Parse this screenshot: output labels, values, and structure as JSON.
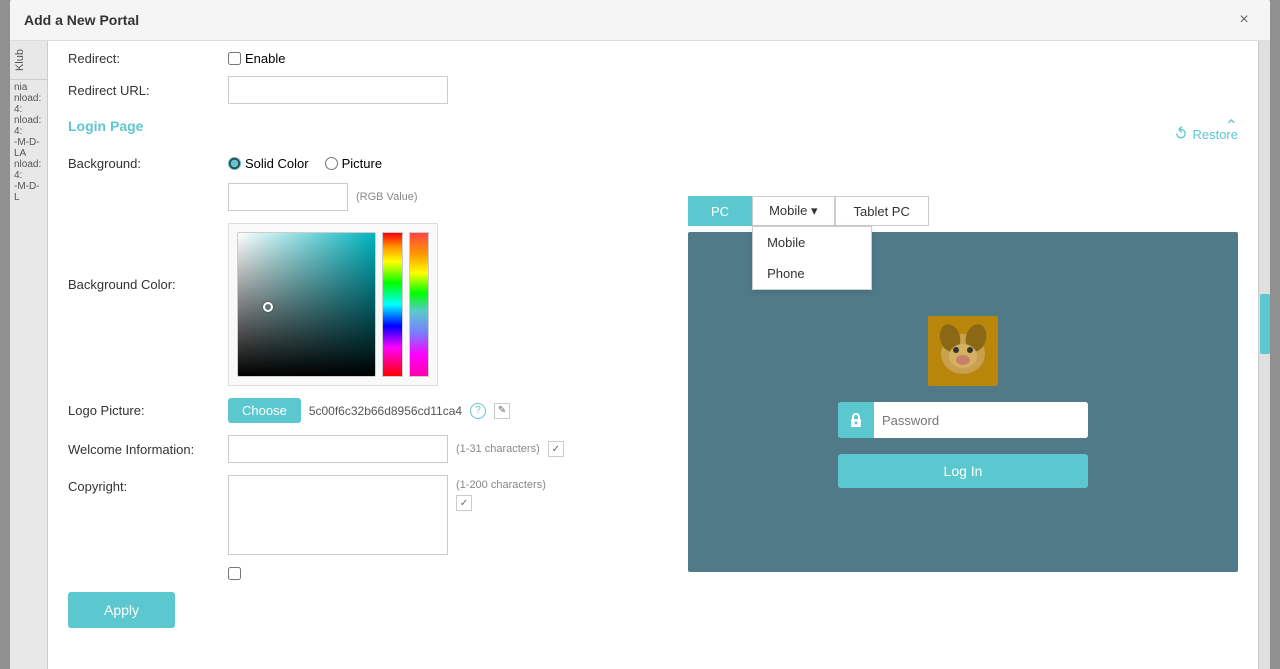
{
  "modal": {
    "title": "Add a New Portal",
    "close_label": "×"
  },
  "sidebar": {
    "label1": "Klub",
    "info1": "nia",
    "info2": "nload:",
    "info3": "4:",
    "info4": "nload:",
    "info5": "4:",
    "info6": "-M-D-LA",
    "info7": "nload:",
    "info8": "4:",
    "info9": "-M-D-L"
  },
  "redirect": {
    "label": "Redirect:",
    "enable_label": "Enable",
    "url_label": "Redirect URL:"
  },
  "login_page": {
    "title": "Login Page"
  },
  "background": {
    "label": "Background:",
    "solid_color_label": "Solid Color",
    "picture_label": "Picture",
    "color_label": "Background Color:",
    "color_value": "#61838b",
    "rgb_hint": "(RGB Value)"
  },
  "color_picker": {
    "cursor_top": "52",
    "cursor_left": "22"
  },
  "logo": {
    "label": "Logo Picture:",
    "choose_btn": "Choose",
    "filename": "5c00f6c32b66d8956cd11ca4",
    "help_icon": "?",
    "edit_icon": "✎"
  },
  "welcome": {
    "label": "Welcome Information:",
    "placeholder": "",
    "char_info": "(1-31 characters)",
    "info_icon": "✓"
  },
  "copyright": {
    "label": "Copyright:",
    "placeholder": "",
    "char_info": "(1-200 characters)",
    "info_icon": "✓"
  },
  "buttons": {
    "apply": "Apply",
    "restore": "Restore"
  },
  "device_tabs": {
    "pc": "PC",
    "mobile": "Mobile",
    "phone": "Phone",
    "tablet": "Tablet PC"
  },
  "preview": {
    "password_placeholder": "Password",
    "login_btn": "Log In"
  }
}
